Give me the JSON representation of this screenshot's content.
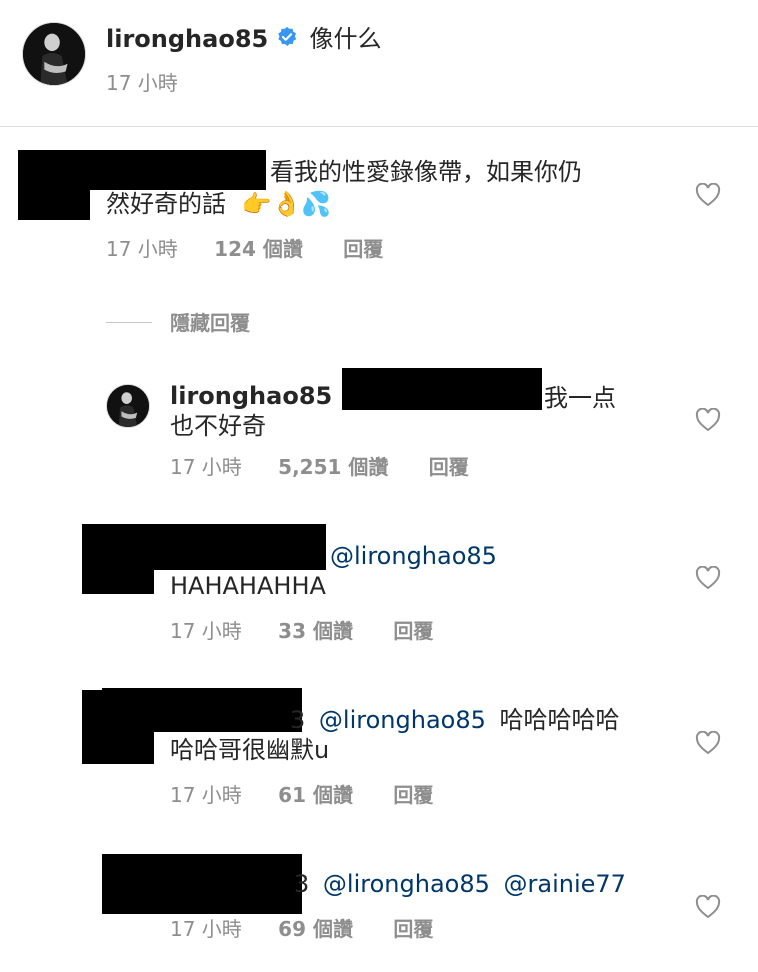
{
  "post": {
    "username": "lironghao85",
    "caption": "像什么",
    "time": "17 小時"
  },
  "comments": [
    {
      "text_line1": "看我的性愛錄像帶，如果你仍",
      "text_line2": "然好奇的話",
      "emojis": "👉👌💦",
      "time": "17 小時",
      "likes": "124 個讚",
      "reply": "回覆"
    }
  ],
  "hide_replies": "隱藏回覆",
  "replies": [
    {
      "username": "lironghao85",
      "text_line1": "我一点",
      "text_line2": "也不好奇",
      "time": "17 小時",
      "likes": "5,251 個讚",
      "reply": "回覆"
    },
    {
      "mention": "@lironghao85",
      "text_line2": "HAHAHAHHA",
      "time": "17 小時",
      "likes": "33 個讚",
      "reply": "回覆"
    },
    {
      "prefix": "3",
      "mention": "@lironghao85",
      "text_line1": "哈哈哈哈哈",
      "text_line2": "哈哈哥很幽默u",
      "time": "17 小時",
      "likes": "61 個讚",
      "reply": "回覆"
    },
    {
      "prefix": "3",
      "mention": "@lironghao85",
      "mention2": "@rainie77",
      "time": "17 小時",
      "likes": "69 個讚",
      "reply": "回覆"
    }
  ],
  "icons": {
    "heart": "heart-icon",
    "verified": "verified-badge-icon",
    "verified_color": "#3897f0"
  }
}
